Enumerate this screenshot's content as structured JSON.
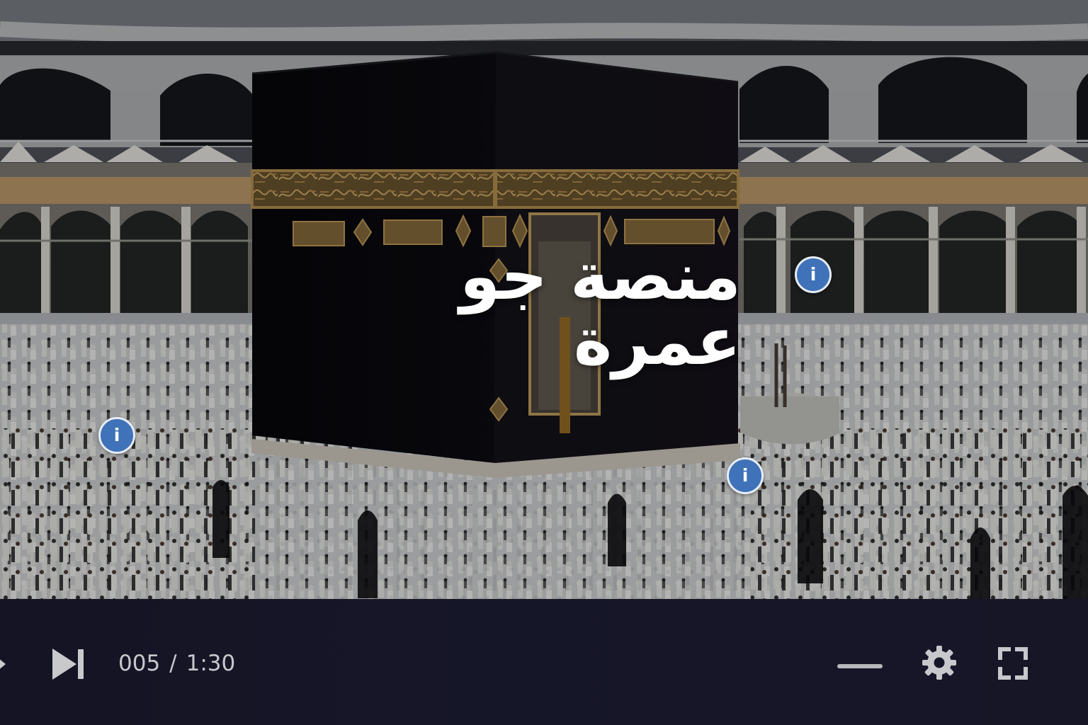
{
  "video": {
    "title": "منصة جو عمرة"
  },
  "hotspots": [
    {
      "label": "i",
      "icon": "info-icon"
    },
    {
      "label": "i",
      "icon": "info-icon"
    },
    {
      "label": "i",
      "icon": "info-icon"
    }
  ],
  "controls": {
    "current_time": "005",
    "separator": "/",
    "duration": "1:30",
    "play_icon": "play-icon",
    "next_icon": "skip-next-icon",
    "volume_icon": "volume-bar",
    "settings_icon": "gear-icon",
    "fullscreen_icon": "fullscreen-icon"
  },
  "colors": {
    "control_bar": "#151528",
    "control_text": "#c7c8cc",
    "hotspot": "#3f72b8",
    "title_text": "#ffffff"
  }
}
